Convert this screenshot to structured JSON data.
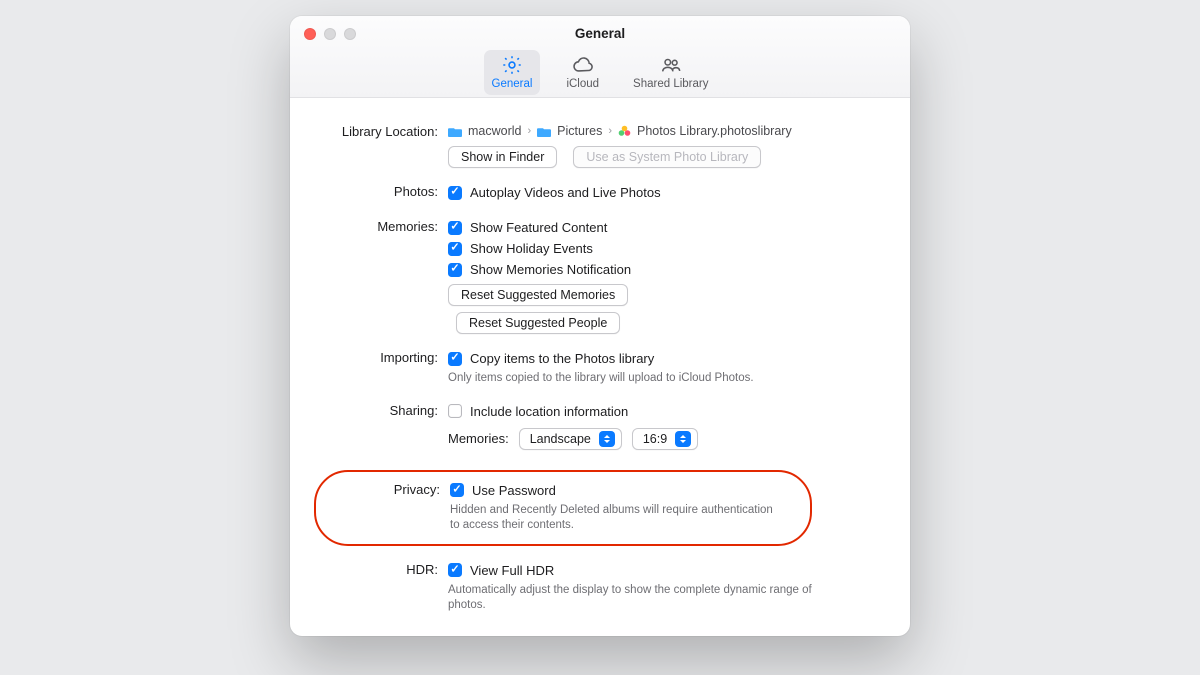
{
  "window": {
    "title": "General"
  },
  "tabs": {
    "general": "General",
    "icloud": "iCloud",
    "shared": "Shared Library"
  },
  "library": {
    "label": "Library Location:",
    "path": [
      {
        "icon": "folder-blue",
        "name": "macworld"
      },
      {
        "icon": "folder-blue",
        "name": "Pictures"
      },
      {
        "icon": "photos-lib",
        "name": "Photos Library.photoslibrary"
      }
    ],
    "show_in_finder": "Show in Finder",
    "use_system": "Use as System Photo Library"
  },
  "photos": {
    "label": "Photos:",
    "autoplay": "Autoplay Videos and Live Photos"
  },
  "memories": {
    "label": "Memories:",
    "featured": "Show Featured Content",
    "holiday": "Show Holiday Events",
    "notify": "Show Memories Notification",
    "reset_suggested_memories": "Reset Suggested Memories",
    "reset_suggested_people": "Reset Suggested People"
  },
  "importing": {
    "label": "Importing:",
    "copy": "Copy items to the Photos library",
    "hint": "Only items copied to the library will upload to iCloud Photos."
  },
  "sharing": {
    "label": "Sharing:",
    "location": "Include location information",
    "memories_label": "Memories:",
    "orientation": "Landscape",
    "aspect": "16:9"
  },
  "privacy": {
    "label": "Privacy:",
    "use_password": "Use Password",
    "hint": "Hidden and Recently Deleted albums will require authentication to access their contents."
  },
  "hdr": {
    "label": "HDR:",
    "view": "View Full HDR",
    "hint": "Automatically adjust the display to show the complete dynamic range of photos."
  }
}
